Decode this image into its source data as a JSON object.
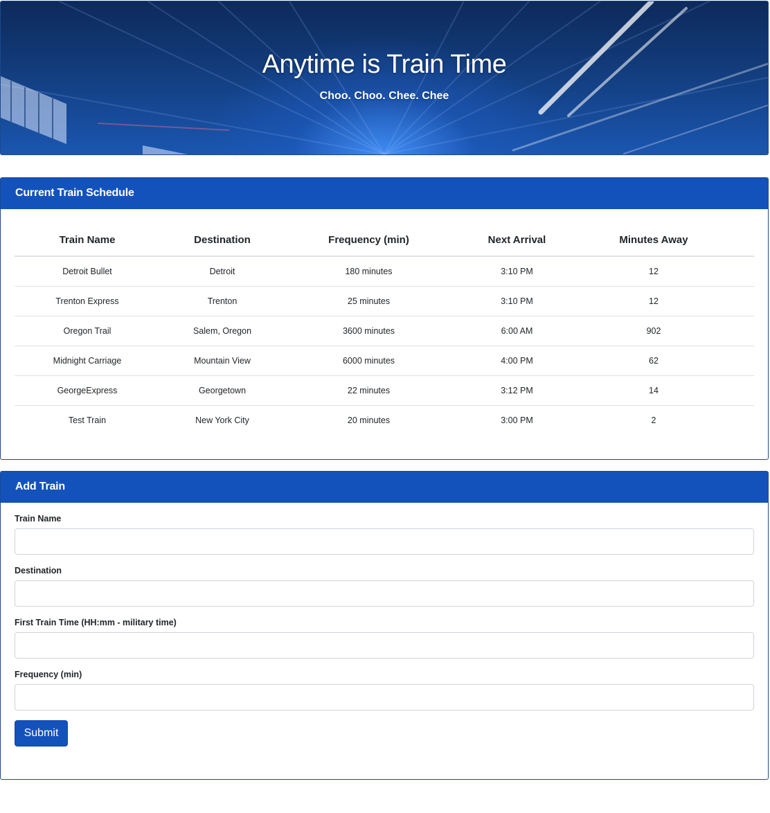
{
  "hero": {
    "title": "Anytime is Train Time",
    "subtitle": "Choo. Choo. Chee. Chee"
  },
  "schedule": {
    "header": "Current Train Schedule",
    "columns": [
      "Train Name",
      "Destination",
      "Frequency (min)",
      "Next Arrival",
      "Minutes Away"
    ],
    "rows": [
      [
        "Detroit Bullet",
        "Detroit",
        "180 minutes",
        "3:10 PM",
        "12"
      ],
      [
        "Trenton Express",
        "Trenton",
        "25 minutes",
        "3:10 PM",
        "12"
      ],
      [
        "Oregon Trail",
        "Salem, Oregon",
        "3600 minutes",
        "6:00 AM",
        "902"
      ],
      [
        "Midnight Carriage",
        "Mountain View",
        "6000 minutes",
        "4:00 PM",
        "62"
      ],
      [
        "GeorgeExpress",
        "Georgetown",
        "22 minutes",
        "3:12 PM",
        "14"
      ],
      [
        "Test Train",
        "New York City",
        "20 minutes",
        "3:00 PM",
        "2"
      ]
    ]
  },
  "add_train": {
    "header": "Add Train",
    "fields": [
      {
        "label": "Train Name",
        "value": "",
        "placeholder": ""
      },
      {
        "label": "Destination",
        "value": "",
        "placeholder": ""
      },
      {
        "label": "First Train Time (HH:mm - military time)",
        "value": "",
        "placeholder": ""
      },
      {
        "label": "Frequency (min)",
        "value": "",
        "placeholder": ""
      }
    ],
    "submit_label": "Submit"
  },
  "colors": {
    "primary": "#1452bb",
    "card_border": "#1a4a8e",
    "hero_dark": "#0d2a5c",
    "hero_light": "#1a56b0"
  }
}
